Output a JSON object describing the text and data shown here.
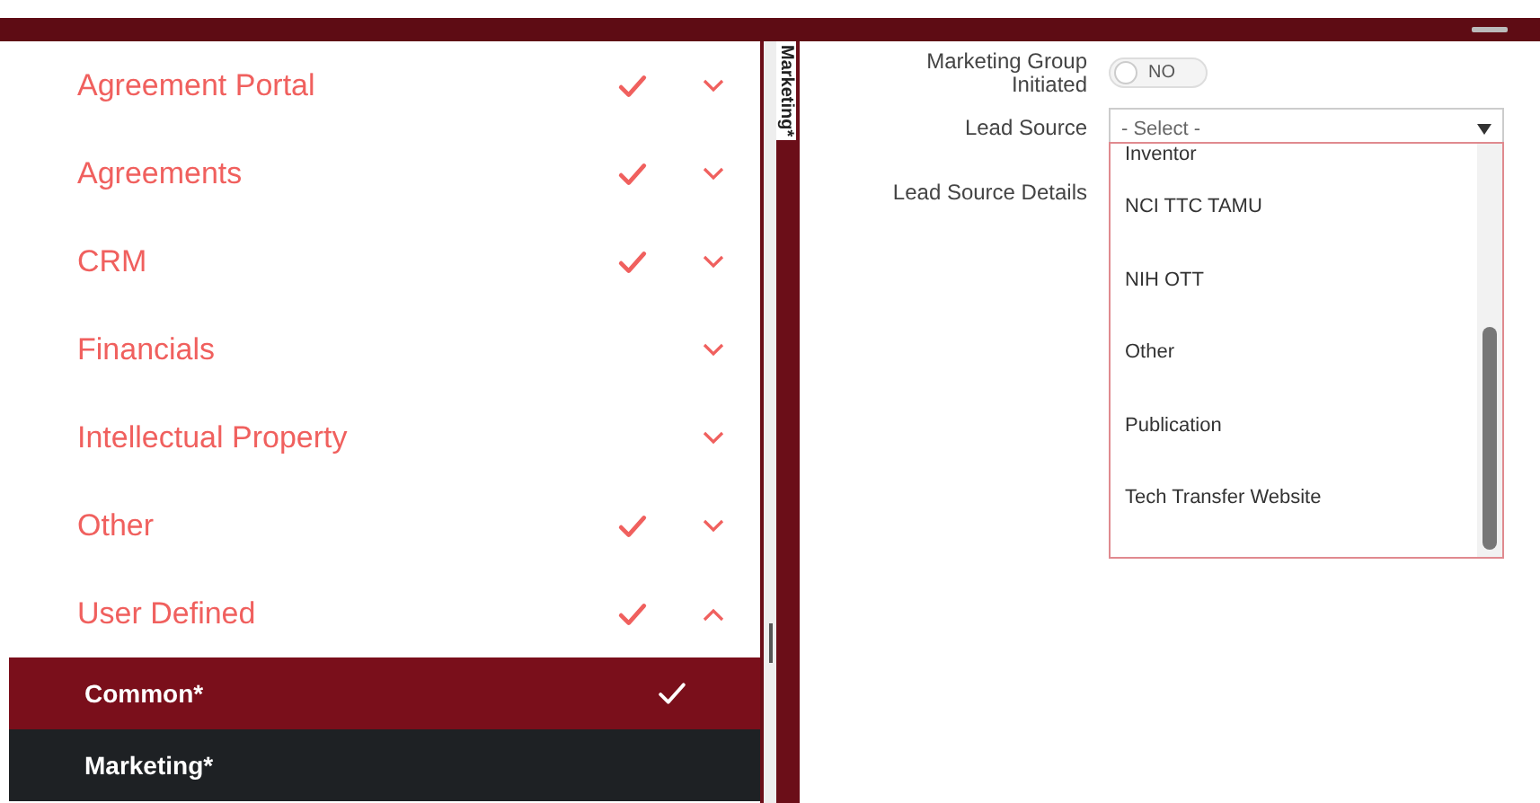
{
  "sidebar": {
    "items": [
      {
        "label": "Agreement Portal",
        "checked": true,
        "expanded": false
      },
      {
        "label": "Agreements",
        "checked": true,
        "expanded": false
      },
      {
        "label": "CRM",
        "checked": true,
        "expanded": false
      },
      {
        "label": "Financials",
        "checked": false,
        "expanded": false
      },
      {
        "label": "Intellectual Property",
        "checked": false,
        "expanded": false
      },
      {
        "label": "Other",
        "checked": true,
        "expanded": false
      },
      {
        "label": "User Defined",
        "checked": true,
        "expanded": true,
        "children": [
          {
            "label": "Common*",
            "checked": true,
            "selected": false
          },
          {
            "label": "Marketing*",
            "checked": false,
            "selected": true
          }
        ]
      }
    ]
  },
  "section": {
    "title": "Marketing*",
    "fields": [
      {
        "kind": "toggle",
        "label": "Marketing Group Initiated",
        "on": false,
        "value": "NO"
      },
      {
        "kind": "select",
        "label": "Lead Source",
        "placeholder": "- Select -",
        "expanded": true,
        "options": [
          "Inventor",
          "NCI TTC TAMU",
          "NIH OTT",
          "Other",
          "Publication",
          "Tech Transfer Website"
        ]
      },
      {
        "kind": "text",
        "label": "Lead Source Details"
      }
    ]
  }
}
